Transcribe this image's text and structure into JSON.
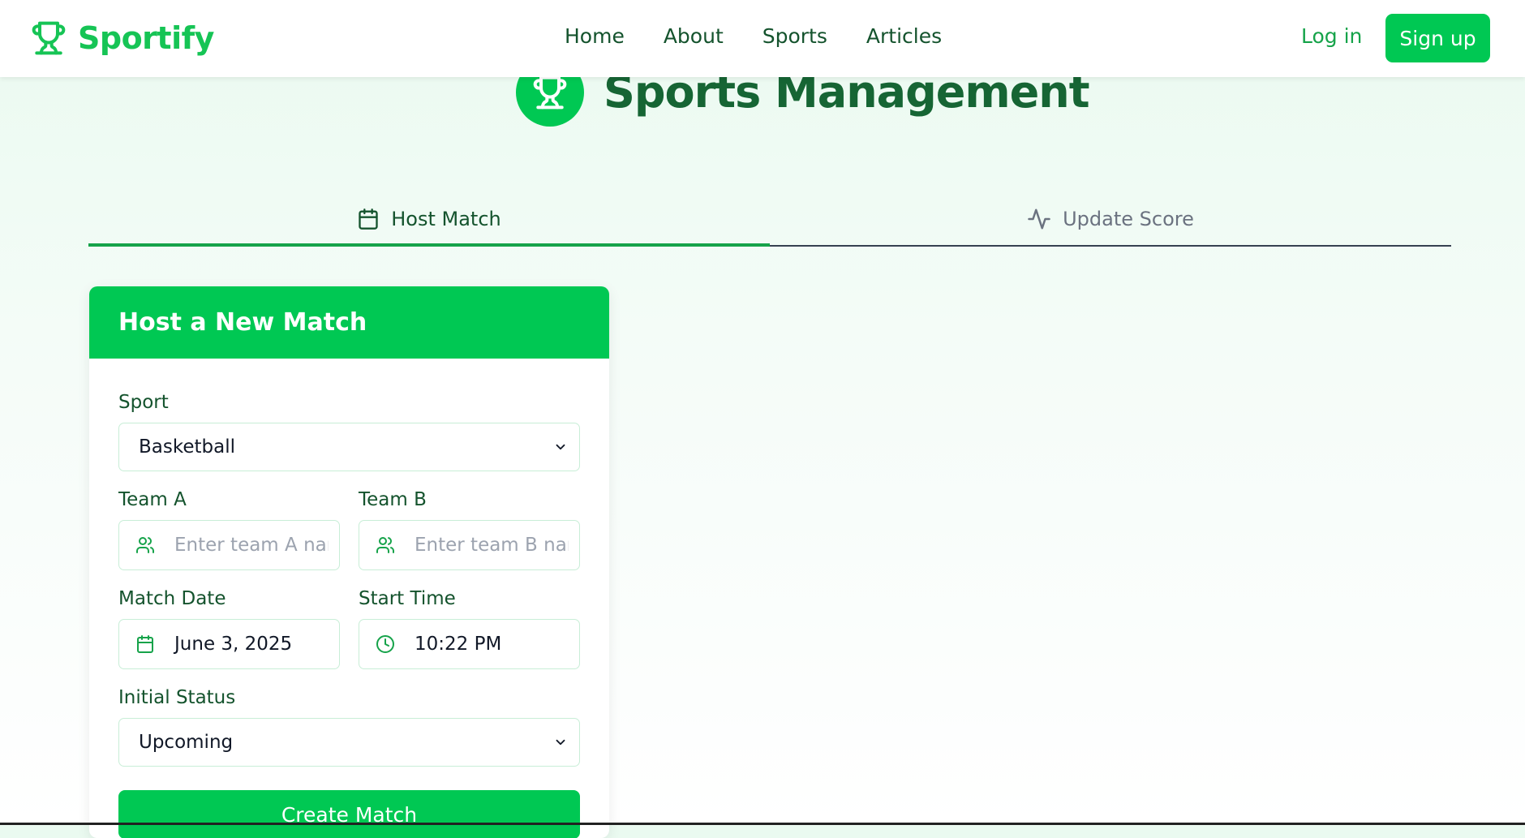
{
  "navbar": {
    "brand": "Sportify",
    "links": [
      {
        "label": "Home"
      },
      {
        "label": "About"
      },
      {
        "label": "Sports"
      },
      {
        "label": "Articles"
      }
    ],
    "login_label": "Log in",
    "signup_label": "Sign up"
  },
  "hero": {
    "title": "Sports Management",
    "icon": "trophy-icon"
  },
  "tabs": [
    {
      "label": "Host Match",
      "icon": "calendar-icon",
      "active": true
    },
    {
      "label": "Update Score",
      "icon": "activity-icon",
      "active": false
    }
  ],
  "form": {
    "title": "Host a New Match",
    "sport": {
      "label": "Sport",
      "value": "Basketball"
    },
    "team_a": {
      "label": "Team A",
      "placeholder": "Enter team A name",
      "value": ""
    },
    "team_b": {
      "label": "Team B",
      "placeholder": "Enter team B name",
      "value": ""
    },
    "match_date": {
      "label": "Match Date",
      "value": "June 3, 2025"
    },
    "start_time": {
      "label": "Start Time",
      "value": "10:22 PM"
    },
    "status": {
      "label": "Initial Status",
      "value": "Upcoming"
    },
    "submit_label": "Create Match"
  },
  "colors": {
    "accent": "#00c853",
    "brand": "#16c455",
    "text_dark": "#14532d",
    "inactive_tab": "#6b7280"
  }
}
